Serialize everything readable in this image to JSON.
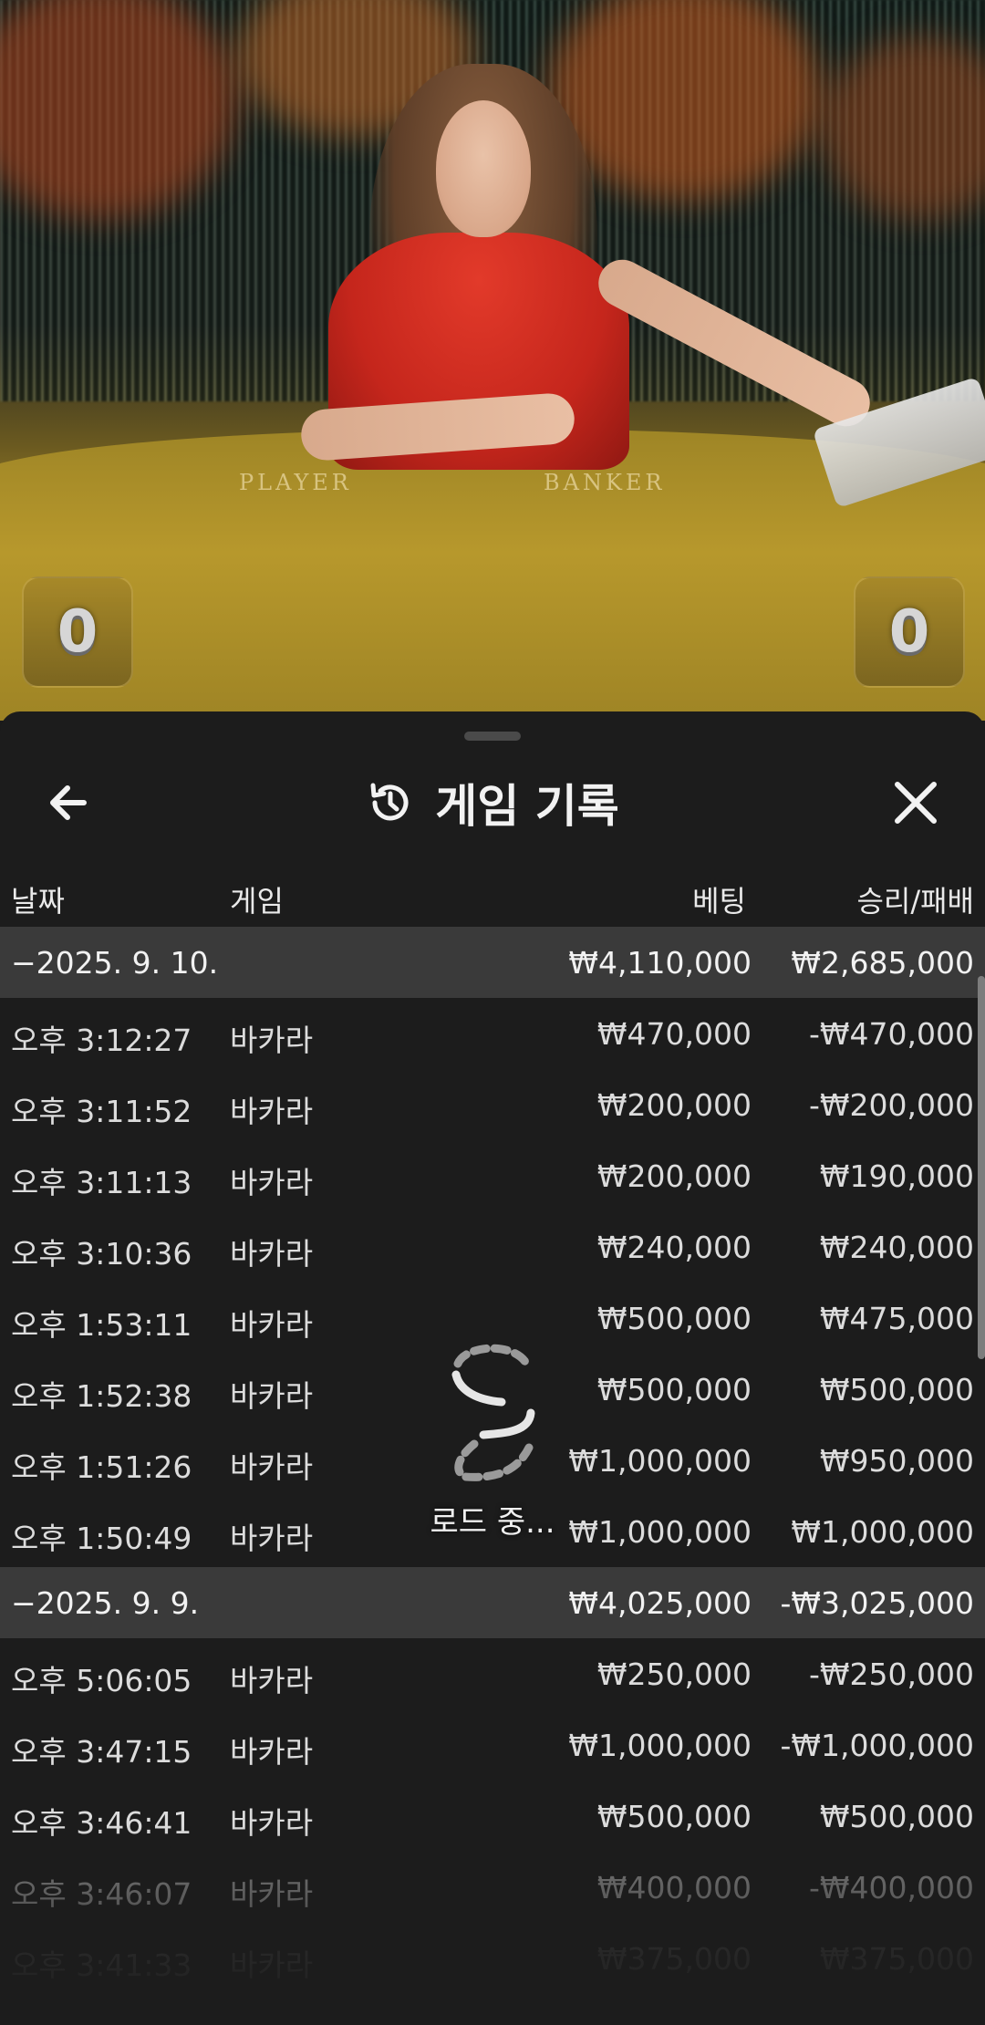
{
  "video": {
    "labels": {
      "player": "PLAYER",
      "banker": "BANKER"
    },
    "scores": {
      "player": "0",
      "banker": "0"
    }
  },
  "header": {
    "title": "게임 기록",
    "icons": {
      "back": "arrow-left-icon",
      "history": "history-icon",
      "close": "close-icon"
    }
  },
  "columns": {
    "date": "날짜",
    "game": "게임",
    "bet": "베팅",
    "win_loss": "승리/패배"
  },
  "groups": [
    {
      "date": "−2025. 9. 10.",
      "bet": "₩4,110,000",
      "win_loss": "₩2,685,000",
      "rows": [
        {
          "time": "오후 3:12:27",
          "game": "바카라",
          "bet": "₩470,000",
          "win_loss": "-₩470,000"
        },
        {
          "time": "오후 3:11:52",
          "game": "바카라",
          "bet": "₩200,000",
          "win_loss": "-₩200,000"
        },
        {
          "time": "오후 3:11:13",
          "game": "바카라",
          "bet": "₩200,000",
          "win_loss": "₩190,000"
        },
        {
          "time": "오후 3:10:36",
          "game": "바카라",
          "bet": "₩240,000",
          "win_loss": "₩240,000"
        },
        {
          "time": "오후 1:53:11",
          "game": "바카라",
          "bet": "₩500,000",
          "win_loss": "₩475,000"
        },
        {
          "time": "오후 1:52:38",
          "game": "바카라",
          "bet": "₩500,000",
          "win_loss": "₩500,000"
        },
        {
          "time": "오후 1:51:26",
          "game": "바카라",
          "bet": "₩1,000,000",
          "win_loss": "₩950,000"
        },
        {
          "time": "오후 1:50:49",
          "game": "바카라",
          "bet": "₩1,000,000",
          "win_loss": "₩1,000,000"
        }
      ]
    },
    {
      "date": "−2025. 9. 9.",
      "bet": "₩4,025,000",
      "win_loss": "-₩3,025,000",
      "rows": [
        {
          "time": "오후 5:06:05",
          "game": "바카라",
          "bet": "₩250,000",
          "win_loss": "-₩250,000"
        },
        {
          "time": "오후 3:47:15",
          "game": "바카라",
          "bet": "₩1,000,000",
          "win_loss": "-₩1,000,000"
        },
        {
          "time": "오후 3:46:41",
          "game": "바카라",
          "bet": "₩500,000",
          "win_loss": "₩500,000"
        },
        {
          "time": "오후 3:46:07",
          "game": "바카라",
          "bet": "₩400,000",
          "win_loss": "-₩400,000"
        },
        {
          "time": "오후 3:41:33",
          "game": "바카라",
          "bet": "₩375,000",
          "win_loss": "₩375,000"
        }
      ]
    }
  ],
  "loading": {
    "text": "로드 중...",
    "icon": "spinner-icon"
  }
}
